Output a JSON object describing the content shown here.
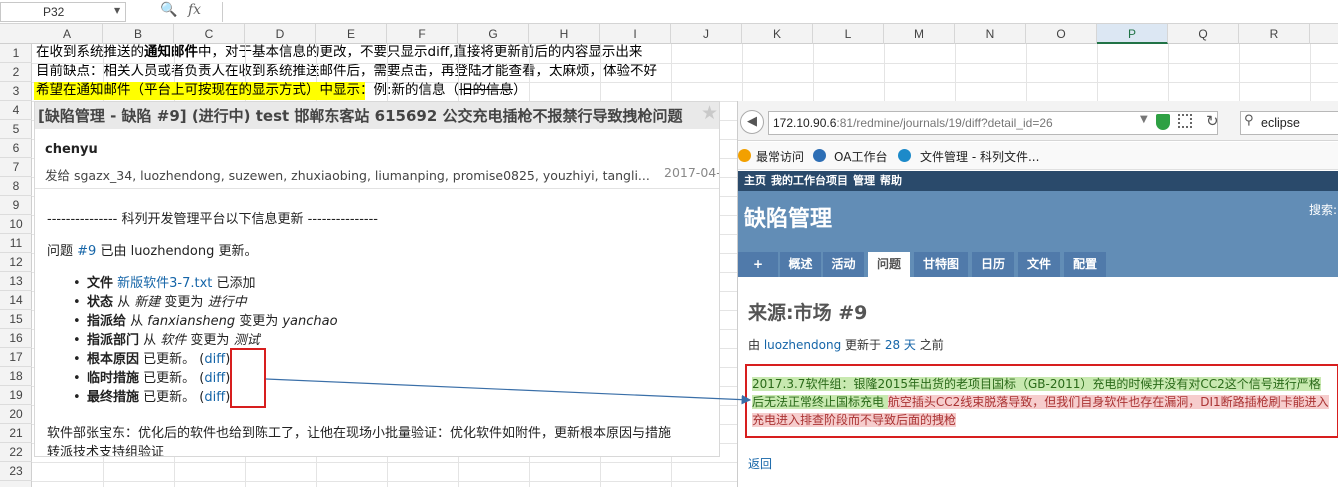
{
  "formula_bar": {
    "cell_ref": "P32",
    "fx": "fx"
  },
  "columns": [
    "A",
    "B",
    "C",
    "D",
    "E",
    "F",
    "G",
    "H",
    "I",
    "J",
    "K",
    "L",
    "M",
    "N",
    "O",
    "P",
    "Q",
    "R"
  ],
  "rows": [
    "1",
    "2",
    "3",
    "4",
    "5",
    "6",
    "7",
    "8",
    "9",
    "10",
    "11",
    "12",
    "13",
    "14",
    "15",
    "16",
    "17",
    "18",
    "19",
    "20",
    "21",
    "22",
    "23"
  ],
  "sheet": {
    "row1_a": "在收到系统推送的",
    "row1_b": "通知邮件",
    "row1_c": "中，对于基本信息的更改，不要只显示diff,直接将更新前后的内容显示出来",
    "row2": "目前缺点：相关人员或者负责人在收到系统推送邮件后，需要点击，再登陆才能查看，太麻烦，体验不好",
    "row3_hl": "希望在通知邮件（平台上可按现在的显示方式）中显示",
    "row3_rest": "：例:新的信息（",
    "row3_strike": "旧的信息",
    "row3_end": "）"
  },
  "email": {
    "title": "[缺陷管理 - 缺陷 #9] (进行中) test 邯郸东客站 615692 公交充电插枪不报禁行导致拽枪问题",
    "sender": "chenyu",
    "recipients": "发给 sgazx_34, luozhendong, suzewen, zhuxiaobing, liumanping, promise0825, youzhiyi, tangli...",
    "date": "2017-04-",
    "platform_line": "--------------- 科列开发管理平台以下信息更新 ---------------",
    "issue_prefix": "问题 ",
    "issue_link": "#9",
    "issue_suffix": " 已由 luozhendong 更新。",
    "items": [
      {
        "label": "文件",
        "pre": " ",
        "link": "新版软件3-7.txt",
        "post": " 已添加"
      },
      {
        "label": "状态",
        "pre": " 从 ",
        "from": "新建",
        "mid": " 变更为 ",
        "to": "进行中"
      },
      {
        "label": "指派给",
        "pre": " 从 ",
        "from": "fanxiansheng",
        "mid": " 变更为 ",
        "to": "yanchao"
      },
      {
        "label": "指派部门",
        "pre": " 从 ",
        "from": "软件",
        "mid": " 变更为 ",
        "to": "测试"
      },
      {
        "label": "根本原因",
        "pre": " 已更新。 (",
        "link": "diff",
        "post": ")"
      },
      {
        "label": "临时措施",
        "pre": " 已更新。 (",
        "link": "diff",
        "post": ")"
      },
      {
        "label": "最终措施",
        "pre": " 已更新。 (",
        "link": "diff",
        "post": ")"
      }
    ],
    "footer1": "软件部张宝东：优化后的软件也给到陈工了，让他在现场小批量验证：优化软件如附件，更新根本原因与措施",
    "footer2": "转派技术支持组验证"
  },
  "browser": {
    "url_host": "172.10.90.6",
    "url_rest": ":81/redmine/journals/19/diff?detail_id=26",
    "search": "eclipse",
    "bookmarks": [
      "最常访问",
      "OA工作台",
      "文件管理 - 科列文件..."
    ],
    "top_menu": [
      "主页",
      "我的工作台",
      "项目",
      "管理",
      "帮助"
    ],
    "project": "缺陷管理",
    "search_label": "搜索:",
    "tabs": [
      "+",
      "概述",
      "活动",
      "问题",
      "甘特图",
      "日历",
      "文件",
      "配置"
    ],
    "heading": "来源:市场 #9",
    "updated_by": "由 ",
    "updated_user": "luozhendong",
    "updated_mid": " 更新于 ",
    "updated_time": "28 天",
    "updated_end": " 之前",
    "diff_line1": "2017.3.7软件组：银隆2015年出货的老项目国标（GB-2011）充电的时候并没有对CC2这个信号进行严格",
    "diff_line2a": "后无法正常终止国标充电 ",
    "diff_line2b": "航空插头CC2线束脱落导致，但我们自身软件也存在漏洞，DI1断路插枪刷卡能进入",
    "diff_line3": "充电进入排查阶段而不导致后面的拽枪",
    "back": "返回"
  },
  "colors": {
    "accent_red": "#d71e1e",
    "link": "#1565a8",
    "redmine_header": "#628db6",
    "redmine_top": "#2a4a6b",
    "highlight": "#ffff00"
  }
}
